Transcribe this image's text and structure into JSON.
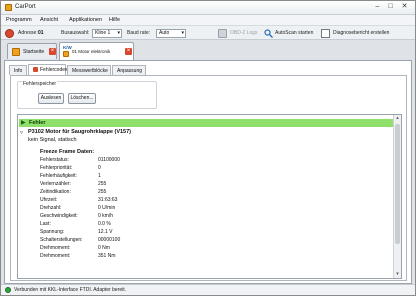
{
  "window": {
    "title": "CarPort"
  },
  "menu": [
    "Programm",
    "Ansicht",
    "Applikationen",
    "Hilfe"
  ],
  "toolbar": {
    "adresse_label": "Adresse:",
    "adresse_value": "01",
    "busauswahl_label": "Busauswahl:",
    "busauswahl_value": "Kline 1",
    "baudrate_label": "Baud rate:",
    "baudrate_value": "Auto",
    "obd_logs": "OBD-2 Logs",
    "autoscan": "AutoScan starten",
    "diagnose": "Diagnosebericht erstellen"
  },
  "doc_tabs": {
    "start": "Startseite",
    "ecu_code": "K/W",
    "ecu_sub": "01 Motor elektronik"
  },
  "sub_tabs": [
    "Info",
    "Fehlercodes",
    "Messwertblöcke",
    "Anpassung"
  ],
  "fehlerspeicher": {
    "label": "Fehlerspeicher",
    "read_button": "Auslesen",
    "clear_button": "Löschen..."
  },
  "fault": {
    "header": "Fehler",
    "code": "P3102 Motor für Saugrohrklappe (V157)",
    "status": "kein Signal, statisch"
  },
  "freeze_frame": {
    "title": "Freeze Frame Daten:",
    "rows": [
      {
        "key": "Fehlerstatus:",
        "value": "01100000"
      },
      {
        "key": "Fehlerpriorität:",
        "value": "0"
      },
      {
        "key": "Fehlerhäufigkeit:",
        "value": "1"
      },
      {
        "key": "Verlernzähler:",
        "value": "255"
      },
      {
        "key": "Zeitindikation:",
        "value": "255"
      },
      {
        "key": "Uhrzeit:",
        "value": "31:63:63"
      },
      {
        "key": "Drehzahl:",
        "value": "0 U/min"
      },
      {
        "key": "Geschwindigkeit:",
        "value": "0 km/h"
      },
      {
        "key": "Last:",
        "value": "0.0 %"
      },
      {
        "key": "Spannung:",
        "value": "12.1 V"
      },
      {
        "key": "Schalterstellungen:",
        "value": "00000100"
      },
      {
        "key": "Drehmoment:",
        "value": "0 Nm"
      },
      {
        "key": "Drehmoment:",
        "value": "351 Nm"
      }
    ]
  },
  "status": {
    "text": "Verbunden mit KKL-Interface FTDI. Adapter bereit."
  },
  "colors": {
    "fault_header": "#8ee06a",
    "status_ok": "#2fa53a",
    "close_red": "#d9472f",
    "tab_orange": "#f0a020"
  }
}
